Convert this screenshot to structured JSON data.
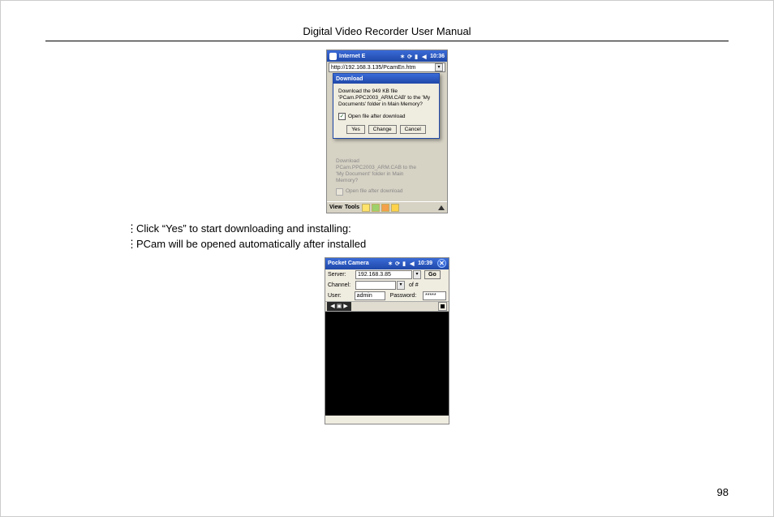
{
  "header": {
    "title": "Digital Video Recorder User Manual"
  },
  "page_number": "98",
  "body": {
    "line1": "Click “Yes” to start downloading and installing:",
    "line2": "PCam will be opened automatically after installed"
  },
  "shot1": {
    "titlebar": {
      "app": "Internet E",
      "time": "10:36"
    },
    "address": "http://192.168.3.135/PcamEn.htm",
    "dialog": {
      "title": "Download",
      "msg_l1": "Download the 949 KB file",
      "msg_l2": "'PCam.PPC2003_ARM.CAB' to the 'My",
      "msg_l3": "Documents' folder in Main Memory?",
      "checkbox_label": "Open file after download",
      "buttons": {
        "yes": "Yes",
        "change": "Change",
        "cancel": "Cancel"
      }
    },
    "ghost": {
      "l0": "Download",
      "l1": "PCam.PPC2003_ARM.CAB to the",
      "l2": "'My Document' folder in Main",
      "l3": "Memory?",
      "chk": "Open file after download"
    },
    "bottombar": {
      "view": "View",
      "tools": "Tools"
    }
  },
  "shot2": {
    "titlebar": {
      "app": "Pocket Camera",
      "time": "10:39"
    },
    "labels": {
      "server": "Server:",
      "channel": "Channel:",
      "user": "User:",
      "password": "Password:",
      "of": "of #",
      "go": "Go"
    },
    "values": {
      "server": "192.168.3.85",
      "user": "admin",
      "password": "*****"
    }
  }
}
